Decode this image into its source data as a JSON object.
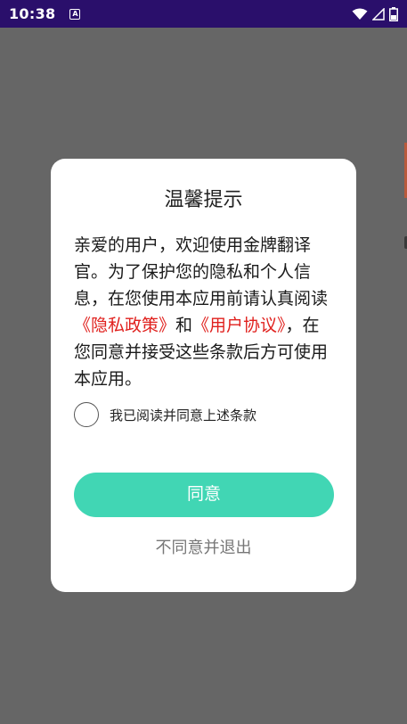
{
  "status_bar": {
    "time": "10:38",
    "notification_icon": "A",
    "icons": [
      "wifi-icon",
      "signal-icon",
      "battery-icon"
    ]
  },
  "dialog": {
    "title": "温馨提示",
    "body_before": "亲爱的用户，欢迎使用金牌翻译官。为了保护您的隐私和个人信息，在您使用本应用前请认真阅读",
    "privacy_link": "《隐私政策》",
    "and": "和",
    "agreement_link": "《用户协议》",
    "body_after": "，在您同意并接受这些条款后方可使用本应用。",
    "checkbox_label": "我已阅读并同意上述条款",
    "agree_button": "同意",
    "decline_link": "不同意并退出"
  },
  "colors": {
    "accent": "#41d6b4",
    "link": "#e0201d",
    "overlay": "#666666",
    "status_bar": "#2a0f6b"
  }
}
